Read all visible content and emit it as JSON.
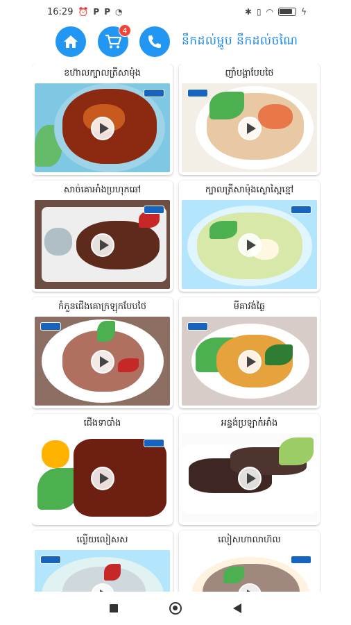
{
  "status_bar": {
    "time": "16:29",
    "left_icons": [
      "alarm-icon",
      "p-icon",
      "p-icon",
      "app-icon"
    ],
    "right_icons": [
      "bluetooth-icon",
      "vibrate-icon",
      "wifi-icon",
      "battery-icon",
      "charging-icon"
    ],
    "notif_p1": "P",
    "notif_p2": "P"
  },
  "header": {
    "title": "នឹកដល់ម្ហូប នឹកដល់ចណៃ",
    "cart_count": "4",
    "accent_color": "#2196f3",
    "badge_color": "#f44336"
  },
  "dishes": [
    {
      "title": "ខហ៊ាលក្បាលត្រីសាម៉ុង"
    },
    {
      "title": "ញាំបង្គាបែបថៃ"
    },
    {
      "title": "សាច់គោអាំងប្រហុកឆៅ"
    },
    {
      "title": "ក្បាលត្រីសាម៉ុងស្ងោស្ពៃខ្មៅ"
    },
    {
      "title": "កំភួនជើងគោក្រឡុកបែបថៃ"
    },
    {
      "title": "មីគាវង់ឆ្ងៃ"
    },
    {
      "title": "ជើងទាបាំង"
    },
    {
      "title": "អន្ទង់ប្រឡាក់អាំង"
    },
    {
      "title": "ល្ងើយលៀសស"
    },
    {
      "title": "លៀសហាលាហ៊ល"
    }
  ],
  "nav": {
    "items": [
      "recents-button",
      "home-button",
      "back-button"
    ]
  }
}
